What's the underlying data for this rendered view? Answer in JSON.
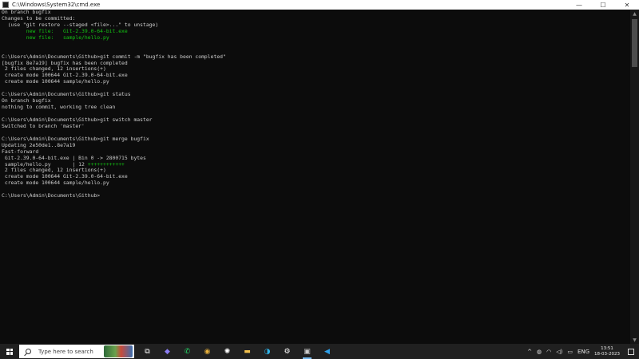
{
  "window": {
    "title": "C:\\Windows\\System32\\cmd.exe",
    "minimize": "—",
    "maximize": "☐",
    "close": "✕"
  },
  "terminal": {
    "lines": [
      [
        {
          "t": "On branch bugfix"
        }
      ],
      [
        {
          "t": "Changes to be committed:"
        }
      ],
      [
        {
          "t": "  (use \"git restore --staged <file>...\" to unstage)"
        }
      ],
      [
        {
          "t": "        "
        },
        {
          "t": "new file:   Git-2.39.0-64-bit.exe",
          "c": "g"
        }
      ],
      [
        {
          "t": "        "
        },
        {
          "t": "new file:   sample/hello.py",
          "c": "g"
        }
      ],
      [
        {
          "t": ""
        }
      ],
      [
        {
          "t": ""
        }
      ],
      [
        {
          "t": "C:\\Users\\Admin\\Documents\\Github>git commit -m \"bugfix has been completed\""
        }
      ],
      [
        {
          "t": "[bugfix 8e7a19] bugfix has been completed"
        }
      ],
      [
        {
          "t": " 2 files changed, 12 insertions(+)"
        }
      ],
      [
        {
          "t": " create mode 100644 Git-2.39.0-64-bit.exe"
        }
      ],
      [
        {
          "t": " create mode 100644 sample/hello.py"
        }
      ],
      [
        {
          "t": ""
        }
      ],
      [
        {
          "t": "C:\\Users\\Admin\\Documents\\Github>git status"
        }
      ],
      [
        {
          "t": "On branch bugfix"
        }
      ],
      [
        {
          "t": "nothing to commit, working tree clean"
        }
      ],
      [
        {
          "t": ""
        }
      ],
      [
        {
          "t": "C:\\Users\\Admin\\Documents\\Github>git switch master"
        }
      ],
      [
        {
          "t": "Switched to branch 'master'"
        }
      ],
      [
        {
          "t": ""
        }
      ],
      [
        {
          "t": "C:\\Users\\Admin\\Documents\\Github>git merge bugfix"
        }
      ],
      [
        {
          "t": "Updating 2e50de1..8e7a19"
        }
      ],
      [
        {
          "t": "Fast-forward"
        }
      ],
      [
        {
          "t": " Git-2.39.0-64-bit.exe | Bin 0 -> 2800715 bytes"
        }
      ],
      [
        {
          "t": " sample/hello.py       | 12 "
        },
        {
          "t": "++++++++++++",
          "c": "g"
        }
      ],
      [
        {
          "t": " 2 files changed, 12 insertions(+)"
        }
      ],
      [
        {
          "t": " create mode 100644 Git-2.39.0-64-bit.exe"
        }
      ],
      [
        {
          "t": " create mode 100644 sample/hello.py"
        }
      ],
      [
        {
          "t": ""
        }
      ],
      [
        {
          "t": "C:\\Users\\Admin\\Documents\\Github>"
        }
      ]
    ]
  },
  "taskbar": {
    "search_placeholder": "Type here to search",
    "apps": [
      {
        "name": "task-view-icon",
        "glyph": "⧉",
        "color": "#ffffff"
      },
      {
        "name": "copilot-icon",
        "glyph": "◆",
        "color": "#8a7cf0"
      },
      {
        "name": "whatsapp-icon",
        "glyph": "✆",
        "color": "#25d366"
      },
      {
        "name": "chrome-icon",
        "glyph": "◉",
        "color": "#e8b13b"
      },
      {
        "name": "chatgpt-icon",
        "glyph": "✺",
        "color": "#ffffff"
      },
      {
        "name": "file-explorer-icon",
        "glyph": "▬",
        "color": "#f2c14e"
      },
      {
        "name": "edge-icon",
        "glyph": "◑",
        "color": "#2fb3e8"
      },
      {
        "name": "settings-icon",
        "glyph": "⚙",
        "color": "#ffffff"
      },
      {
        "name": "terminal-icon",
        "glyph": "▣",
        "color": "#cccccc",
        "active": true
      },
      {
        "name": "vscode-icon",
        "glyph": "◀",
        "color": "#2f9fe8"
      }
    ],
    "tray": {
      "chevron": "^",
      "language": "ENG",
      "time": "13:51",
      "date": "18-03-2023"
    }
  }
}
